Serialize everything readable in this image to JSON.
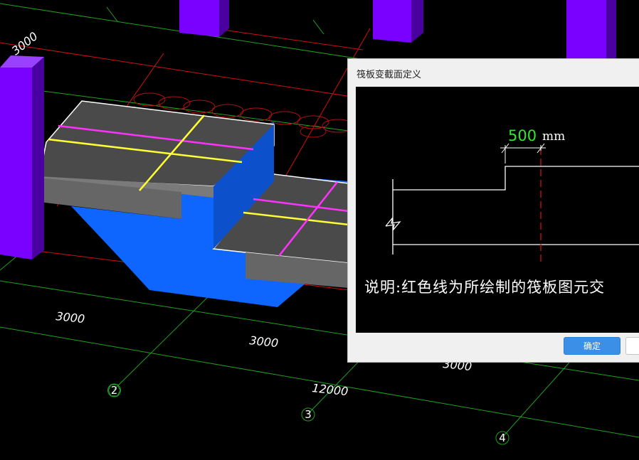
{
  "viewport": {
    "dimension_labels": [
      "3000",
      "3000",
      "3000",
      "12000",
      "3000"
    ],
    "axis_labels": [
      "2",
      "3",
      "4"
    ],
    "colors": {
      "grid_green": "#1fa01f",
      "grid_red": "#d01010",
      "column_purple": "#7a00ff",
      "raft_top": "#4a4a4a",
      "raft_side": "#666666",
      "raft_under": "#0f66ff",
      "rebar_magenta": "#ff33ff",
      "rebar_yellow": "#ffff33"
    }
  },
  "dialog": {
    "title": "筏板变截面定义",
    "preview": {
      "dimension_value": "500",
      "dimension_unit": "mm",
      "note": "说明:红色线为所绘制的筏板图元交"
    },
    "ok_label": "确定",
    "cancel_label": ""
  }
}
